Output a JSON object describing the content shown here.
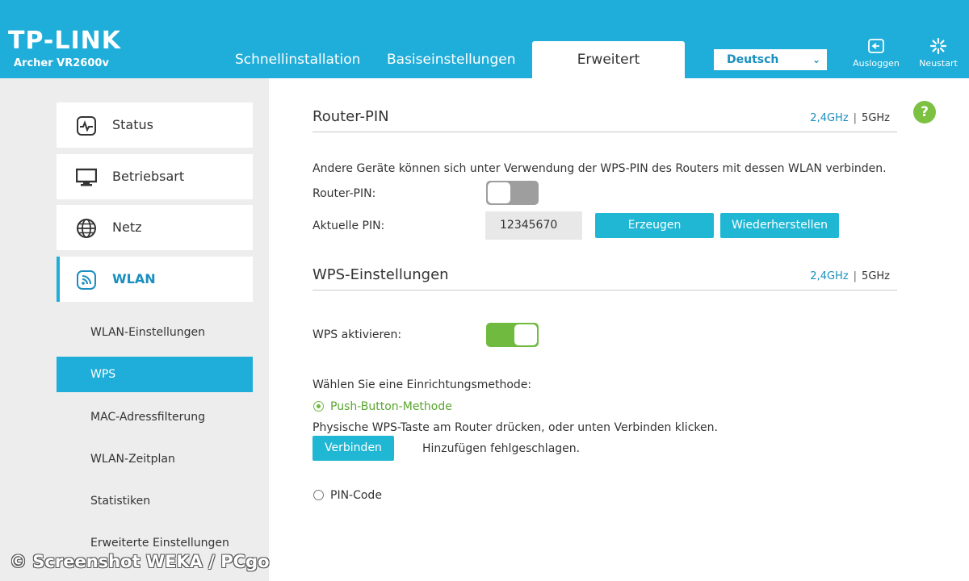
{
  "header": {
    "brand": "TP-LINK",
    "model": "Archer VR2600v",
    "nav": [
      "Schnellinstallation",
      "Basiseinstellungen",
      "Erweitert"
    ],
    "language": "Deutsch",
    "logout_label": "Ausloggen",
    "restart_label": "Neustart",
    "accent_color": "#1fadd9"
  },
  "sidebar": {
    "items": [
      {
        "label": "Status",
        "icon": "status-pulse-icon"
      },
      {
        "label": "Betriebsart",
        "icon": "monitor-icon"
      },
      {
        "label": "Netz",
        "icon": "globe-icon"
      },
      {
        "label": "WLAN",
        "icon": "wifi-icon"
      }
    ],
    "sub_items": [
      "WLAN-Einstellungen",
      "WPS",
      "MAC-Adressfilterung",
      "WLAN-Zeitplan",
      "Statistiken",
      "Erweiterte Einstellungen"
    ],
    "active_sub": "WPS"
  },
  "router_pin": {
    "title": "Router-PIN",
    "band1": "2,4GHz",
    "separator": "|",
    "band2": "5GHz",
    "description": "Andere Geräte können sich unter Verwendung der WPS-PIN des Routers mit dessen WLAN verbinden.",
    "pin_label": "Router-PIN:",
    "pin_enabled": false,
    "current_pin_label": "Aktuelle PIN:",
    "current_pin": "12345670",
    "generate_label": "Erzeugen",
    "restore_label": "Wiederherstellen"
  },
  "wps": {
    "title": "WPS-Einstellungen",
    "band1": "2,4GHz",
    "separator": "|",
    "band2": "5GHz",
    "enable_label": "WPS aktivieren:",
    "enabled": true,
    "method_prompt": "Wählen Sie eine Einrichtungsmethode:",
    "push_button_label": "Push-Button-Methode",
    "push_instruction": "Physische WPS-Taste am Router drücken, oder unten Verbinden klicken.",
    "connect_label": "Verbinden",
    "status_text": "Hinzufügen fehlgeschlagen.",
    "pin_code_label": "PIN-Code"
  },
  "help_label": "?",
  "watermark": "© Screenshot WEKA / PCgo"
}
